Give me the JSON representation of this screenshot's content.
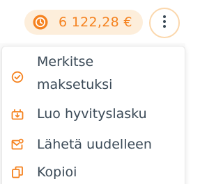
{
  "header": {
    "amount": "6 122,28 €",
    "status_icon": "clock-icon",
    "more_icon": "more-vertical-icon"
  },
  "menu": {
    "items": [
      {
        "label": "Merkitse maksetuksi",
        "icon": "check-circle-icon"
      },
      {
        "label": "Luo hyvityslasku",
        "icon": "credit-note-icon"
      },
      {
        "label": "Lähetä uudelleen",
        "icon": "resend-mail-icon"
      },
      {
        "label": "Kopioi",
        "icon": "copy-icon"
      }
    ]
  },
  "colors": {
    "accent": "#f5821f",
    "pill_bg": "#fdeedb",
    "button_ring": "#fbd7ac",
    "text": "#3b4a57"
  }
}
